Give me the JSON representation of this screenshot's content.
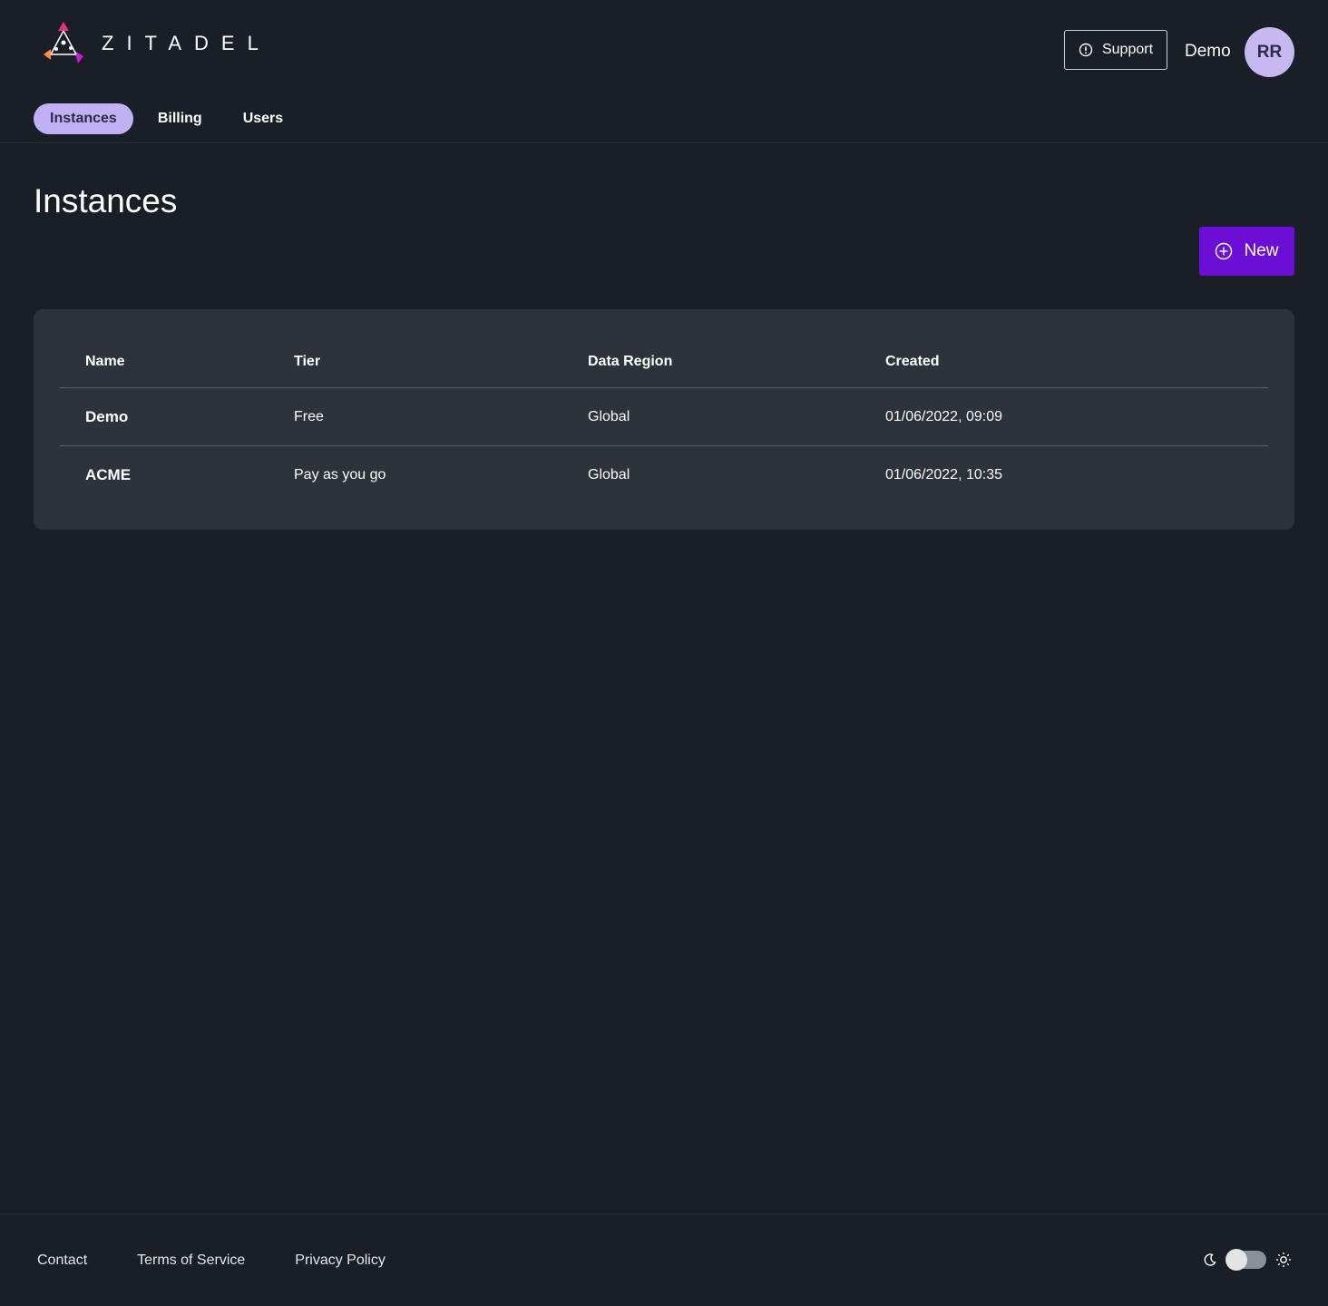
{
  "header": {
    "logo_text": "ZITADEL",
    "support_label": "Support",
    "org_name": "Demo",
    "avatar_initials": "RR"
  },
  "tabs": [
    {
      "label": "Instances",
      "active": true
    },
    {
      "label": "Billing",
      "active": false
    },
    {
      "label": "Users",
      "active": false
    }
  ],
  "main": {
    "title": "Instances",
    "new_button_label": "New"
  },
  "table": {
    "columns": [
      "Name",
      "Tier",
      "Data Region",
      "Created"
    ],
    "rows": [
      {
        "name": "Demo",
        "tier": "Free",
        "region": "Global",
        "created": "01/06/2022, 09:09"
      },
      {
        "name": "ACME",
        "tier": "Pay as you go",
        "region": "Global",
        "created": "01/06/2022, 10:35"
      }
    ]
  },
  "footer": {
    "links": [
      "Contact",
      "Terms of Service",
      "Privacy Policy"
    ]
  },
  "colors": {
    "background": "#1a1e27",
    "card": "#2d323b",
    "accent": "#6b0ed6",
    "tab_active": "#bfb1f3",
    "avatar": "#c8b8f2"
  },
  "icons": {
    "logo": "zitadel-logo-icon",
    "support": "info-circle-icon",
    "new": "plus-circle-icon",
    "dark_mode": "moon-icon",
    "light_mode": "sun-icon"
  }
}
